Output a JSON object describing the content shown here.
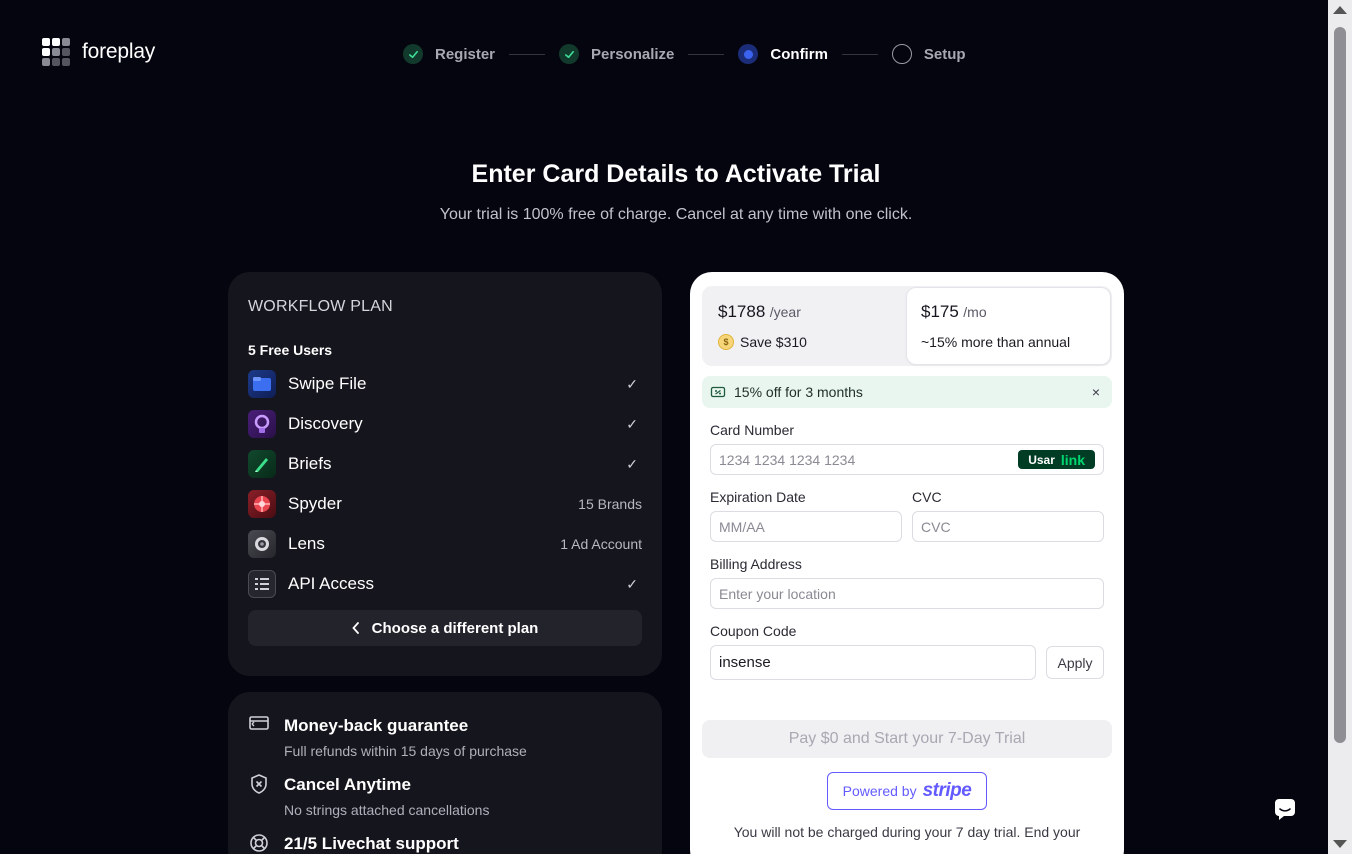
{
  "brand": {
    "name": "foreplay"
  },
  "stepper": [
    {
      "label": "Register",
      "state": "done"
    },
    {
      "label": "Personalize",
      "state": "done"
    },
    {
      "label": "Confirm",
      "state": "active"
    },
    {
      "label": "Setup",
      "state": "todo"
    }
  ],
  "headline": "Enter Card Details to Activate Trial",
  "subline": "Your trial is 100% free of charge. Cancel at any time with one click.",
  "plan": {
    "title": "WORKFLOW PLAN",
    "users": "5 Free Users",
    "features": [
      {
        "name": "Swipe File",
        "value": "✓",
        "icon": "swipe-file-icon"
      },
      {
        "name": "Discovery",
        "value": "✓",
        "icon": "discovery-icon"
      },
      {
        "name": "Briefs",
        "value": "✓",
        "icon": "briefs-icon"
      },
      {
        "name": "Spyder",
        "value": "15 Brands",
        "icon": "spyder-icon"
      },
      {
        "name": "Lens",
        "value": "1 Ad Account",
        "icon": "lens-icon"
      },
      {
        "name": "API Access",
        "value": "✓",
        "icon": "api-access-icon"
      }
    ],
    "choose_label": "Choose a different plan"
  },
  "guarantees": [
    {
      "title": "Money-back guarantee",
      "sub": "Full refunds within 15 days of purchase",
      "icon": "money-back-icon"
    },
    {
      "title": "Cancel Anytime",
      "sub": "No strings attached cancellations",
      "icon": "shield-x-icon"
    },
    {
      "title": "21/5 Livechat support",
      "sub": "",
      "icon": "lifebuoy-icon"
    }
  ],
  "billing": {
    "annual": {
      "price": "$1788",
      "per": "/year",
      "note": "Save $310"
    },
    "monthly": {
      "price": "$175",
      "per": "/mo",
      "note": "~15% more than annual"
    }
  },
  "promo": {
    "text": "15% off for 3 months",
    "close": "×"
  },
  "form": {
    "card_label": "Card Number",
    "card_placeholder": "1234 1234 1234 1234",
    "link_use": "Usar",
    "link_word": "link",
    "exp_label": "Expiration Date",
    "exp_placeholder": "MM/AA",
    "cvc_label": "CVC",
    "cvc_placeholder": "CVC",
    "address_label": "Billing Address",
    "address_placeholder": "Enter your location",
    "coupon_label": "Coupon Code",
    "coupon_value": "insense",
    "apply_label": "Apply"
  },
  "pay_button": "Pay $0 and Start your 7-Day Trial",
  "stripe": {
    "powered": "Powered by",
    "word": "stripe"
  },
  "disclaimer": "You will not be charged during your 7 day trial. End your",
  "colors": {
    "background": "#05050f",
    "card_dark": "#15151d",
    "accent_blue": "#3c63f0",
    "stripe": "#635bff",
    "link_green": "#00d66f"
  }
}
